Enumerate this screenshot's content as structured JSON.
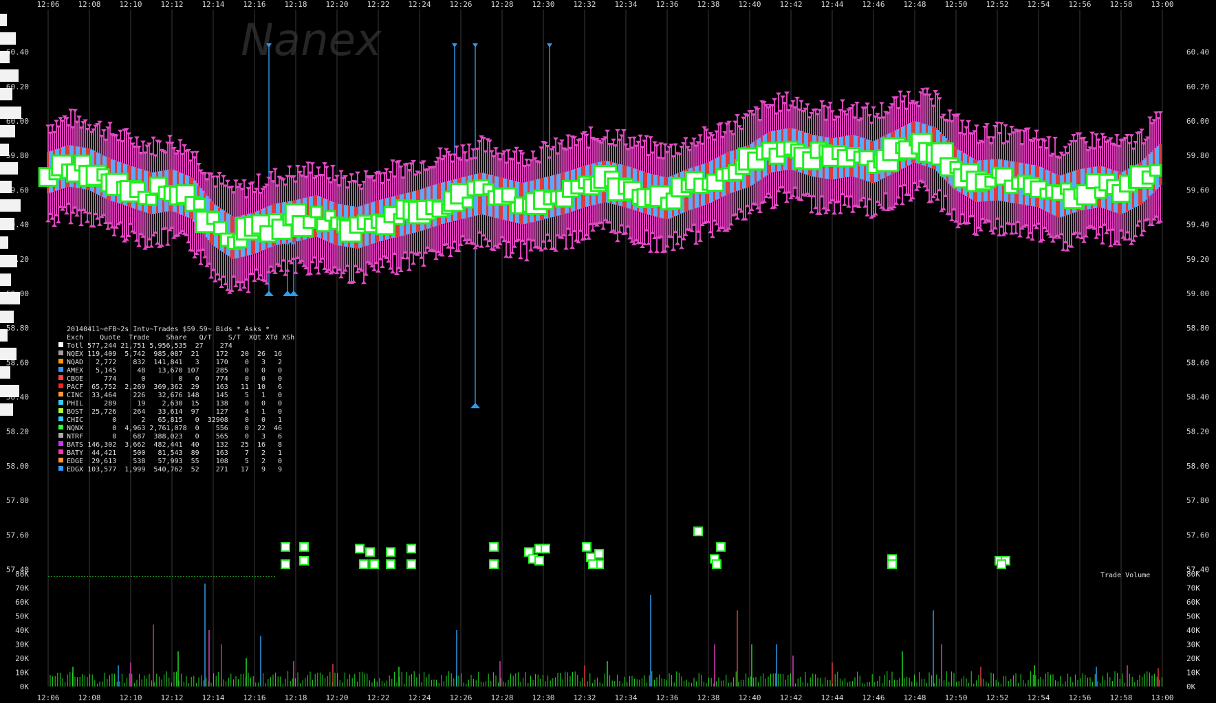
{
  "chart_data": {
    "type": "scatter",
    "title": "20140411~eFB~2s Intv~Trades $59.59~ Bids * Asks *",
    "watermark": "Nanex",
    "xlabel": "",
    "ylabel": "",
    "x_ticks": [
      "12:06",
      "12:08",
      "12:10",
      "12:12",
      "12:14",
      "12:16",
      "12:18",
      "12:20",
      "12:22",
      "12:24",
      "12:26",
      "12:28",
      "12:30",
      "12:32",
      "12:34",
      "12:36",
      "12:38",
      "12:40",
      "12:42",
      "12:44",
      "12:46",
      "12:48",
      "12:50",
      "12:52",
      "12:54",
      "12:56",
      "12:58",
      "13:00"
    ],
    "xlim_minutes": [
      726,
      780
    ],
    "price_ticks": [
      "57.40",
      "57.60",
      "57.80",
      "58.00",
      "58.20",
      "58.40",
      "58.60",
      "58.80",
      "59.00",
      "59.20",
      "59.40",
      "59.60",
      "59.80",
      "60.00",
      "60.20",
      "60.40"
    ],
    "ylim": [
      57.37,
      60.57
    ],
    "volume_ticks": [
      "0K",
      "10K",
      "20K",
      "30K",
      "40K",
      "50K",
      "60K",
      "70K",
      "80K"
    ],
    "volume_label": "Trade Volume",
    "volume_ylim": [
      0,
      80000
    ],
    "price_path": [
      {
        "t": 726.0,
        "p": 59.7
      },
      {
        "t": 727.0,
        "p": 59.74
      },
      {
        "t": 728.0,
        "p": 59.72
      },
      {
        "t": 729.0,
        "p": 59.66
      },
      {
        "t": 730.0,
        "p": 59.62
      },
      {
        "t": 731.0,
        "p": 59.58
      },
      {
        "t": 732.0,
        "p": 59.6
      },
      {
        "t": 733.0,
        "p": 59.55
      },
      {
        "t": 734.0,
        "p": 59.4
      },
      {
        "t": 735.0,
        "p": 59.32
      },
      {
        "t": 736.0,
        "p": 59.35
      },
      {
        "t": 737.0,
        "p": 59.4
      },
      {
        "t": 738.0,
        "p": 59.42
      },
      {
        "t": 739.0,
        "p": 59.45
      },
      {
        "t": 740.0,
        "p": 59.4
      },
      {
        "t": 741.0,
        "p": 59.38
      },
      {
        "t": 742.0,
        "p": 59.42
      },
      {
        "t": 743.0,
        "p": 59.45
      },
      {
        "t": 744.0,
        "p": 59.48
      },
      {
        "t": 745.0,
        "p": 59.52
      },
      {
        "t": 746.0,
        "p": 59.55
      },
      {
        "t": 747.0,
        "p": 59.58
      },
      {
        "t": 748.0,
        "p": 59.55
      },
      {
        "t": 749.0,
        "p": 59.52
      },
      {
        "t": 750.0,
        "p": 59.55
      },
      {
        "t": 751.0,
        "p": 59.58
      },
      {
        "t": 752.0,
        "p": 59.62
      },
      {
        "t": 753.0,
        "p": 59.65
      },
      {
        "t": 754.0,
        "p": 59.62
      },
      {
        "t": 755.0,
        "p": 59.58
      },
      {
        "t": 756.0,
        "p": 59.55
      },
      {
        "t": 757.0,
        "p": 59.6
      },
      {
        "t": 758.0,
        "p": 59.64
      },
      {
        "t": 759.0,
        "p": 59.7
      },
      {
        "t": 760.0,
        "p": 59.74
      },
      {
        "t": 761.0,
        "p": 59.82
      },
      {
        "t": 762.0,
        "p": 59.84
      },
      {
        "t": 763.0,
        "p": 59.8
      },
      {
        "t": 764.0,
        "p": 59.78
      },
      {
        "t": 765.0,
        "p": 59.8
      },
      {
        "t": 766.0,
        "p": 59.76
      },
      {
        "t": 767.0,
        "p": 59.82
      },
      {
        "t": 768.0,
        "p": 59.88
      },
      {
        "t": 769.0,
        "p": 59.84
      },
      {
        "t": 770.0,
        "p": 59.72
      },
      {
        "t": 771.0,
        "p": 59.65
      },
      {
        "t": 772.0,
        "p": 59.66
      },
      {
        "t": 773.0,
        "p": 59.64
      },
      {
        "t": 774.0,
        "p": 59.62
      },
      {
        "t": 775.0,
        "p": 59.56
      },
      {
        "t": 776.0,
        "p": 59.6
      },
      {
        "t": 777.0,
        "p": 59.62
      },
      {
        "t": 778.0,
        "p": 59.58
      },
      {
        "t": 779.0,
        "p": 59.64
      },
      {
        "t": 780.0,
        "p": 59.76
      }
    ],
    "spikes": [
      {
        "t": 736.7,
        "low": 59.0,
        "high": 60.45
      },
      {
        "t": 737.6,
        "low": 59.0,
        "high": 59.3
      },
      {
        "t": 737.9,
        "low": 59.0,
        "high": 59.3
      },
      {
        "t": 745.7,
        "low": 59.5,
        "high": 60.45
      },
      {
        "t": 746.7,
        "low": 58.35,
        "high": 60.45
      },
      {
        "t": 750.3,
        "low": 59.55,
        "high": 60.45
      }
    ],
    "lower_boxes": [
      {
        "t": 737.5,
        "p": 57.53
      },
      {
        "t": 737.5,
        "p": 57.43
      },
      {
        "t": 738.4,
        "p": 57.53
      },
      {
        "t": 738.4,
        "p": 57.45
      },
      {
        "t": 741.1,
        "p": 57.52
      },
      {
        "t": 741.3,
        "p": 57.43
      },
      {
        "t": 741.6,
        "p": 57.5
      },
      {
        "t": 741.8,
        "p": 57.43
      },
      {
        "t": 742.6,
        "p": 57.5
      },
      {
        "t": 742.6,
        "p": 57.43
      },
      {
        "t": 743.6,
        "p": 57.52
      },
      {
        "t": 743.6,
        "p": 57.43
      },
      {
        "t": 747.6,
        "p": 57.53
      },
      {
        "t": 747.6,
        "p": 57.43
      },
      {
        "t": 749.3,
        "p": 57.5
      },
      {
        "t": 749.5,
        "p": 57.46
      },
      {
        "t": 749.8,
        "p": 57.52
      },
      {
        "t": 750.1,
        "p": 57.52
      },
      {
        "t": 749.8,
        "p": 57.45
      },
      {
        "t": 752.1,
        "p": 57.53
      },
      {
        "t": 752.3,
        "p": 57.47
      },
      {
        "t": 752.7,
        "p": 57.49
      },
      {
        "t": 752.7,
        "p": 57.43
      },
      {
        "t": 752.4,
        "p": 57.43
      },
      {
        "t": 757.5,
        "p": 57.62
      },
      {
        "t": 758.6,
        "p": 57.53
      },
      {
        "t": 758.3,
        "p": 57.46
      },
      {
        "t": 758.4,
        "p": 57.43
      },
      {
        "t": 766.9,
        "p": 57.46
      },
      {
        "t": 766.9,
        "p": 57.43
      },
      {
        "t": 772.1,
        "p": 57.45
      },
      {
        "t": 772.4,
        "p": 57.45
      },
      {
        "t": 772.2,
        "p": 57.43
      }
    ],
    "volume_spikes": [
      {
        "t": 727.2,
        "v": 14000
      },
      {
        "t": 729.4,
        "v": 15000
      },
      {
        "t": 730.0,
        "v": 17000
      },
      {
        "t": 731.1,
        "v": 44000
      },
      {
        "t": 732.3,
        "v": 25000
      },
      {
        "t": 733.6,
        "v": 73000
      },
      {
        "t": 733.8,
        "v": 40000
      },
      {
        "t": 734.4,
        "v": 30000
      },
      {
        "t": 735.6,
        "v": 20000
      },
      {
        "t": 736.3,
        "v": 36000
      },
      {
        "t": 737.9,
        "v": 18000
      },
      {
        "t": 739.8,
        "v": 16000
      },
      {
        "t": 743.0,
        "v": 14000
      },
      {
        "t": 745.8,
        "v": 40000
      },
      {
        "t": 747.9,
        "v": 18000
      },
      {
        "t": 752.0,
        "v": 15000
      },
      {
        "t": 753.1,
        "v": 18000
      },
      {
        "t": 755.2,
        "v": 65000
      },
      {
        "t": 758.3,
        "v": 30000
      },
      {
        "t": 759.4,
        "v": 54000
      },
      {
        "t": 760.1,
        "v": 30000
      },
      {
        "t": 761.3,
        "v": 30000
      },
      {
        "t": 762.1,
        "v": 22000
      },
      {
        "t": 764.0,
        "v": 17000
      },
      {
        "t": 767.4,
        "v": 25000
      },
      {
        "t": 768.9,
        "v": 54000
      },
      {
        "t": 769.3,
        "v": 30000
      },
      {
        "t": 771.2,
        "v": 14000
      },
      {
        "t": 773.8,
        "v": 15000
      },
      {
        "t": 776.8,
        "v": 14000
      },
      {
        "t": 778.3,
        "v": 15000
      },
      {
        "t": 779.8,
        "v": 13000
      }
    ],
    "threshold_line": {
      "t0": 726.0,
      "t1": 737.0,
      "p": 57.36
    },
    "series_colors": {
      "NQEX": "#a0a0a0",
      "NQAD": "#ff9900",
      "AMEX": "#3399ff",
      "CBOE": "#ff4444",
      "PACF": "#ff2222",
      "CINC": "#ff9933",
      "PHIL": "#33ccff",
      "BOST": "#aaff33",
      "CHIC": "#33ccff",
      "NQNX": "#33ff33",
      "NTRF": "#aaaaaa",
      "BATS": "#cc33ff",
      "BATY": "#ff33aa",
      "EDGE": "#ff9933",
      "EDGX": "#3399ff"
    },
    "stats_table": {
      "header": "Exch    Quote  Trade    Share   Q/T    S/T  XQt XTd XSh",
      "rows": [
        {
          "mark": "#ffffff",
          "text": "Totl 577,244 21,751 5,956,535  27    274"
        },
        {
          "mark": "#a0a0a0",
          "text": "NQEX 119,409  5,742  985,087  21    172   20  26  16"
        },
        {
          "mark": "#ff9900",
          "text": "NQAD   2,772    832  141,841   3    170    0   3   2"
        },
        {
          "mark": "#3399ff",
          "text": "AMEX   5,145     48   13,670 107    285    0   0   0"
        },
        {
          "mark": "#ff4444",
          "text": "CBOE     774      0        0   0    774    0   0   0"
        },
        {
          "mark": "#ff2222",
          "text": "PACF  65,752  2,269  369,362  29    163   11  10   6"
        },
        {
          "mark": "#ff9933",
          "text": "CINC  33,464    226   32,676 148    145    5   1   0"
        },
        {
          "mark": "#33ccff",
          "text": "PHIL     289     19    2,630  15    138    0   0   0"
        },
        {
          "mark": "#aaff33",
          "text": "BOST  25,726    264   33,614  97    127    4   1   0"
        },
        {
          "mark": "#33ccff",
          "text": "CHIC       0      2   65,815   0  32908    0   0   1"
        },
        {
          "mark": "#33ff33",
          "text": "NQNX       0  4,963 2,761,078  0    556    0  22  46"
        },
        {
          "mark": "#aaaaaa",
          "text": "NTRF       0    687  388,023   0    565    0   3   6"
        },
        {
          "mark": "#cc33ff",
          "text": "BATS 146,302  3,662  482,441  40    132   25  16   8"
        },
        {
          "mark": "#ff33aa",
          "text": "BATY  44,421    500   81,543  89    163    7   2   1"
        },
        {
          "mark": "#ff9933",
          "text": "EDGE  29,613    538   57,993  55    108    5   2   0"
        },
        {
          "mark": "#3399ff",
          "text": "EDGX 103,577  1,999  540,762  52    271   17   9   9"
        }
      ]
    }
  }
}
